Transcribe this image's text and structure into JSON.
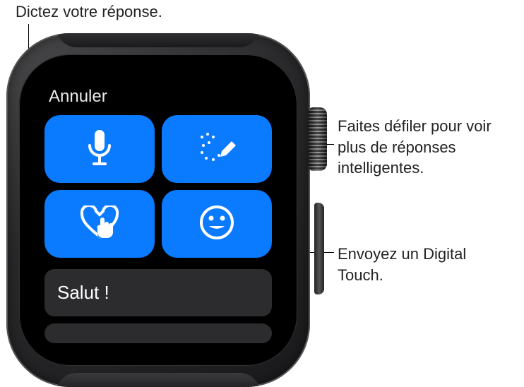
{
  "callouts": {
    "dictate": "Dictez votre réponse.",
    "scroll": "Faites défiler pour voir plus de réponses intelligentes.",
    "digital_touch": "Envoyez un Digital Touch."
  },
  "watch": {
    "cancel_label": "Annuler",
    "buttons": {
      "dictate": "microphone-icon",
      "scribble": "scribble-icon",
      "digital_touch": "digital-touch-icon",
      "emoji": "emoji-icon"
    },
    "smart_replies": [
      "Salut !"
    ],
    "colors": {
      "accent": "#0a7aff",
      "reply_bg": "#2c2c2e"
    }
  }
}
